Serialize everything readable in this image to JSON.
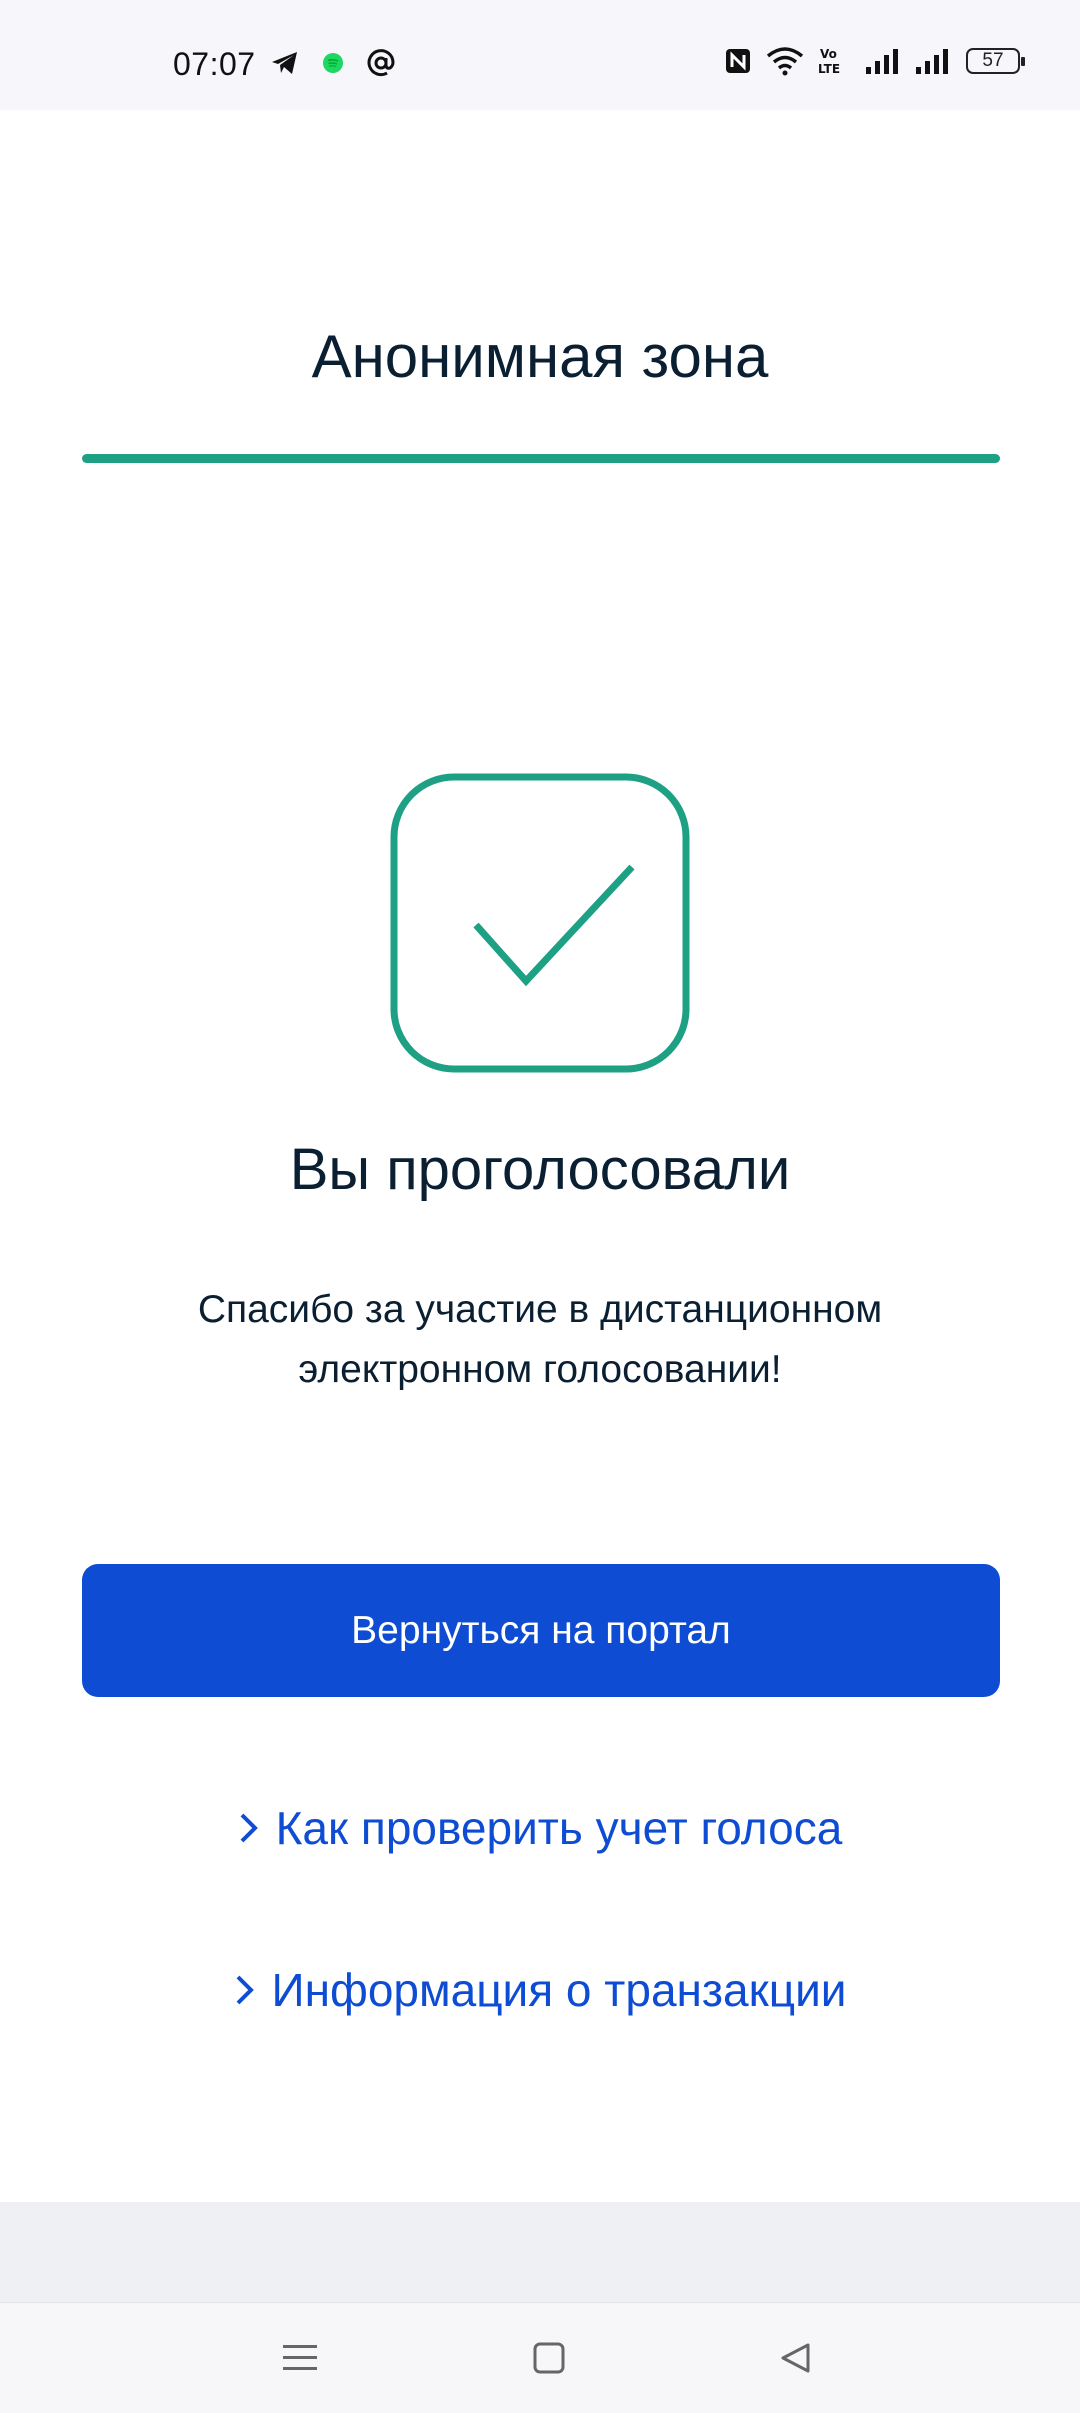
{
  "status_bar": {
    "time": "07:07",
    "left_icons": [
      "telegram-icon",
      "spotify-icon",
      "at-sign-icon"
    ],
    "right_icons": [
      "nfc-icon",
      "wifi-icon",
      "volte-icon",
      "signal-1-icon",
      "signal-2-icon",
      "battery-icon"
    ],
    "battery_level": "57"
  },
  "header": {
    "title": "Анонимная зона",
    "divider_color": "#1EA084"
  },
  "result": {
    "icon": "checkmark-square-icon",
    "icon_color": "#1EA084",
    "title": "Вы проголосовали",
    "message_line1": "Спасибо за участие в дистанционном",
    "message_line2": "электронном голосовании!"
  },
  "actions": {
    "primary_button_label": "Вернуться на портал",
    "primary_color": "#0D4CD3",
    "link_check_vote": "Как проверить учет голоса",
    "link_transaction_info": "Информация о транзакции"
  },
  "nav": {
    "items": [
      "menu-icon",
      "home-icon",
      "back-icon"
    ]
  }
}
